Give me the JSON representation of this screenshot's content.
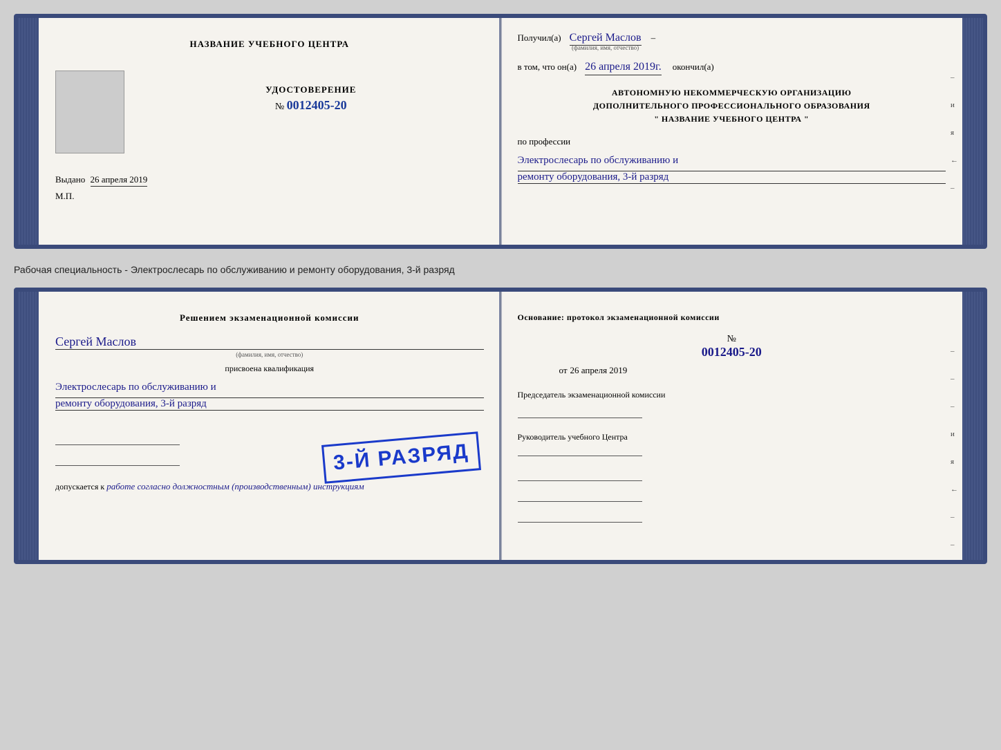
{
  "top_cert": {
    "left": {
      "training_center": "НАЗВАНИЕ УЧЕБНОГО ЦЕНТРА",
      "udostoverenie_label": "УДОСТОВЕРЕНИЕ",
      "number_prefix": "№",
      "number": "0012405-20",
      "vydano_label": "Выдано",
      "vydano_date": "26 апреля 2019",
      "mp_label": "М.П."
    },
    "right": {
      "poluchil_label": "Получил(а)",
      "recipient_name": "Сергей Маслов",
      "fio_label": "(фамилия, имя, отчество)",
      "dash": "–",
      "vtom_label": "в том, что он(а)",
      "vtom_date": "26 апреля 2019г.",
      "okoncil_label": "окончил(а)",
      "org_line1": "АВТОНОМНУЮ НЕКОММЕРЧЕСКУЮ ОРГАНИЗАЦИЮ",
      "org_line2": "ДОПОЛНИТЕЛЬНОГО ПРОФЕССИОНАЛЬНОГО ОБРАЗОВАНИЯ",
      "org_line3": "\"    НАЗВАНИЕ УЧЕБНОГО ЦЕНТРА    \"",
      "po_professii_label": "по профессии",
      "profession_line1": "Электрослесарь по обслуживанию и",
      "profession_line2": "ремонту оборудования, 3-й разряд"
    }
  },
  "between_text": "Рабочая специальность - Электрослесарь по обслуживанию и ремонту оборудования, 3-й разряд",
  "bottom_cert": {
    "left": {
      "resheniem_title": "Решением экзаменационной комиссии",
      "recipient_name": "Сергей Маслов",
      "fio_label": "(фамилия, имя, отчество)",
      "prisvoena_label": "присвоена квалификация",
      "qualification_line1": "Электрослесарь по обслуживанию и",
      "qualification_line2": "ремонту оборудования, 3-й разряд",
      "dopuskaetsya_label": "допускается к",
      "dopuskaetsya_text": "работе согласно должностным (производственным) инструкциям",
      "stamp_text": "3-й разряд"
    },
    "right": {
      "osnovanie_label": "Основание: протокол экзаменационной комиссии",
      "number_prefix": "№",
      "protocol_number": "0012405-20",
      "ot_label": "от",
      "ot_date": "26 апреля 2019",
      "predsedatel_label": "Председатель экзаменационной комиссии",
      "rukovoditel_label": "Руководитель учебного Центра"
    }
  },
  "side_marks": {
    "mark_i": "и",
    "mark_ya": "я",
    "mark_arrow": "←",
    "dashes": [
      "–",
      "–",
      "–",
      "–",
      "–"
    ]
  }
}
